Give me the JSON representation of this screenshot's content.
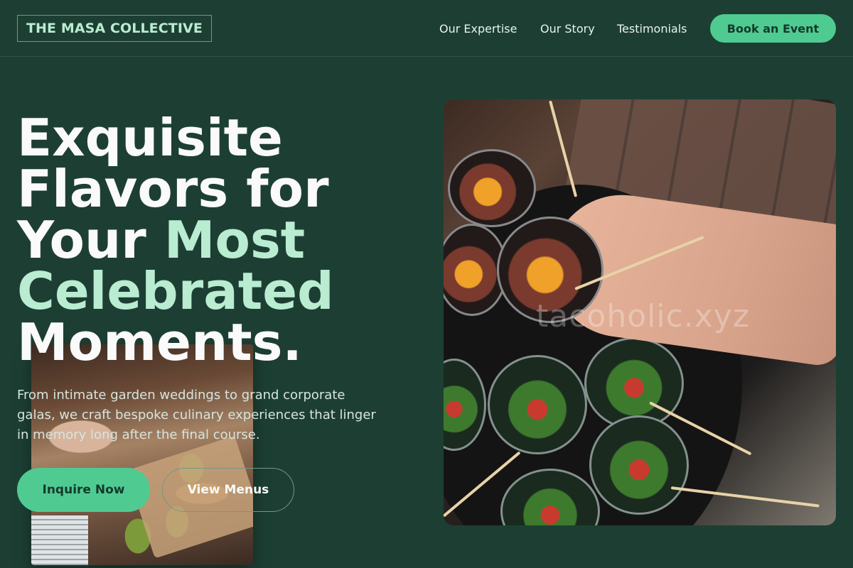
{
  "header": {
    "logo": "THE MASA COLLECTIVE",
    "nav": [
      "Our Expertise",
      "Our Story",
      "Testimonials"
    ],
    "cta": "Book an Event"
  },
  "hero": {
    "headline_part1": "Exquisite Flavors for Your ",
    "headline_highlight": "Most Celebrated",
    "headline_part2": " Moments.",
    "subtitle": "From intimate garden weddings to grand corporate galas, we craft bespoke culinary experiences that linger in memory long after the final course.",
    "primary_button": "Inquire Now",
    "secondary_button": "View Menus",
    "photo_watermark": "tacoholic.xyz"
  },
  "colors": {
    "background": "#1d3f33",
    "accent": "#4fcb92",
    "highlight_text": "#b9ecd1"
  }
}
